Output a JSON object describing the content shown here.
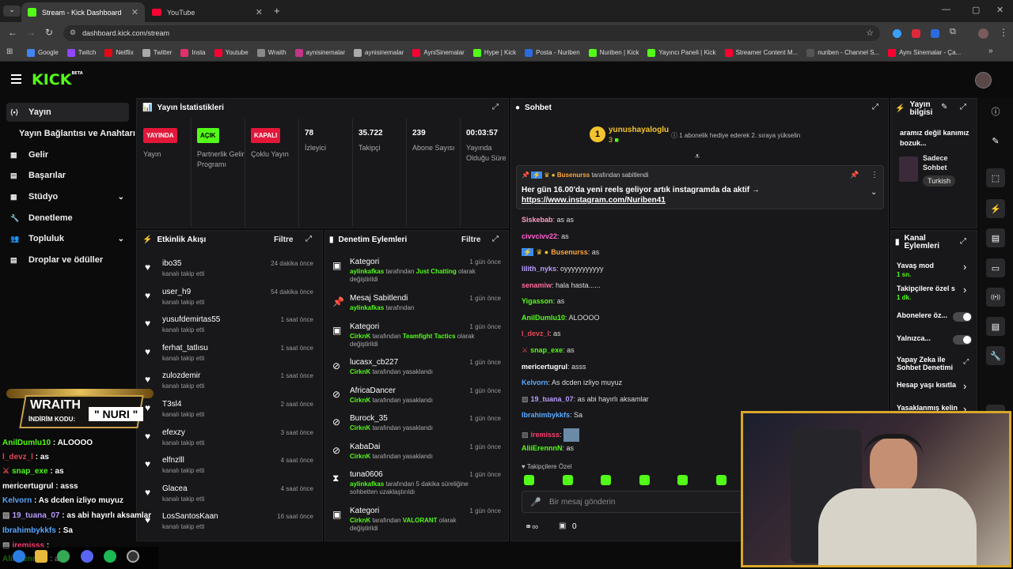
{
  "browser": {
    "tabs": [
      {
        "label": "Stream - Kick Dashboard"
      },
      {
        "label": "YouTube"
      }
    ],
    "url": "dashboard.kick.com/stream",
    "bookmarks": [
      "Google",
      "Twitch",
      "Netflix",
      "Twitter",
      "Insta",
      "Youtube",
      "Wraith",
      "aynisinemalar",
      "aynisinemalar",
      "AyniSinemalar",
      "Hype | Kick",
      "Posta - Nuriben",
      "Nuriben | Kick",
      "Yayıncı Paneli | Kick",
      "Streamer Content M...",
      "nuriben - Channel S...",
      "Aynı Sinemalar - Ça..."
    ]
  },
  "header": {
    "logo": "KICK",
    "beta": "BETA"
  },
  "sidebar": {
    "items": [
      {
        "label": "Yayın"
      },
      {
        "label": "Yayın Bağlantısı ve Anahtarı"
      },
      {
        "label": "Gelir"
      },
      {
        "label": "Başarılar"
      },
      {
        "label": "Stüdyo"
      },
      {
        "label": "Denetleme"
      },
      {
        "label": "Topluluk"
      },
      {
        "label": "Droplar ve ödüller"
      }
    ]
  },
  "stats": {
    "title": "Yayın İstatistikleri",
    "items": [
      {
        "badge": "YAYINDA",
        "label": "Yayın"
      },
      {
        "badge": "AÇIK",
        "label": "Partnerlik Gelir Programı"
      },
      {
        "badge": "KAPALI",
        "label": "Çoklu Yayın"
      },
      {
        "value": "78",
        "label": "İzleyici"
      },
      {
        "value": "35.722",
        "label": "Takipçi"
      },
      {
        "value": "239",
        "label": "Abone Sayısı"
      },
      {
        "value": "00:03:57",
        "label": "Yayında Olduğu Süre"
      }
    ]
  },
  "activity": {
    "title": "Etkinlik Akışı",
    "filter": "Filtre",
    "sub": "kanalı takip etti",
    "items": [
      {
        "name": "ibo35",
        "time": "24 dakika önce"
      },
      {
        "name": "user_h9",
        "time": "54 dakika önce"
      },
      {
        "name": "yusufdemirtas55",
        "time": "1 saat önce"
      },
      {
        "name": "ferhat_tatlısu",
        "time": "1 saat önce"
      },
      {
        "name": "zulozdemir",
        "time": "1 saat önce"
      },
      {
        "name": "T3sl4",
        "time": "2 saat önce"
      },
      {
        "name": "efexzy",
        "time": "3 saat önce"
      },
      {
        "name": "elfnzlll",
        "time": "4 saat önce"
      },
      {
        "name": "Glacea",
        "time": "4 saat önce"
      },
      {
        "name": "LosSantosKaan",
        "time": "16 saat önce"
      }
    ]
  },
  "moderation": {
    "title": "Denetim Eylemleri",
    "filter": "Filtre",
    "items": [
      {
        "name": "Kategori",
        "time": "1 gün önce",
        "user": "aylinkafkas",
        "mid": " tarafından ",
        "g2": "Just Chatting",
        "end": " olarak değiştirildi"
      },
      {
        "name": "Mesaj Sabitlendi",
        "time": "1 gün önce",
        "user": "aylinkafkas",
        "mid": " tarafından",
        "g2": "",
        "end": ""
      },
      {
        "name": "Kategori",
        "time": "1 gün önce",
        "user": "CirknK",
        "mid": " tarafından ",
        "g2": "Teamfight Tactics",
        "end": " olarak değiştirildi"
      },
      {
        "name": "lucasx_cb227",
        "time": "1 gün önce",
        "user": "CirknK",
        "mid": " tarafından yasaklandı",
        "g2": "",
        "end": ""
      },
      {
        "name": "AfricaDancer",
        "time": "1 gün önce",
        "user": "CirknK",
        "mid": " tarafından yasaklandı",
        "g2": "",
        "end": ""
      },
      {
        "name": "Burock_35",
        "time": "1 gün önce",
        "user": "CirknK",
        "mid": " tarafından yasaklandı",
        "g2": "",
        "end": ""
      },
      {
        "name": "KabaDai",
        "time": "1 gün önce",
        "user": "CirknK",
        "mid": " tarafından yasaklandı",
        "g2": "",
        "end": ""
      },
      {
        "name": "tuna0606",
        "time": "1 gün önce",
        "user": "aylinkafkas",
        "mid": " tarafından 5 dakika süreliğine sohbetten uzaklaştırıldı",
        "g2": "",
        "end": ""
      },
      {
        "name": "Kategori",
        "time": "1 gün önce",
        "user": "CirknK",
        "mid": " tarafından ",
        "g2": "VALORANT",
        "end": " olarak değiştirildi"
      }
    ]
  },
  "chat": {
    "title": "Sohbet",
    "gift_user": "yunushayaloglu",
    "gift_count": "3",
    "gift_text": "1 abonelik hediye ederek 2. sıraya yükselin",
    "pinned_by": "Busenurss",
    "pinned_by_text": " tarafından sabitlendi",
    "pinned_text": "Her gün 16.00'da yeni reels geliyor artık instagramda da aktif →",
    "pinned_link": "https://www.instagram.com/Nuriben41",
    "messages": [
      {
        "user": "Siskebab",
        "color": "#ff9ec6",
        "text": "as as"
      },
      {
        "user": "civvcivv22",
        "color": "#ff5fd0",
        "text": "as"
      },
      {
        "user": "Busenurss",
        "color": "#ffa53c",
        "text": "as"
      },
      {
        "user": "lilith_nyks",
        "color": "#b99cff",
        "text": "oyyyyyyyyyyy"
      },
      {
        "user": "senamiw",
        "color": "#ff6a9a",
        "text": "hala hasta......"
      },
      {
        "user": "Yigasson",
        "color": "#53fc18",
        "text": "as"
      },
      {
        "user": "AnilDumlu10",
        "color": "#53fc18",
        "text": "ALOOOO"
      },
      {
        "user": "l_devz_l",
        "color": "#e0485c",
        "text": "as"
      },
      {
        "user": "snap_exe",
        "color": "#53fc18",
        "text": "as"
      },
      {
        "user": "mericertugrul",
        "color": "#ffffff",
        "text": "asss"
      },
      {
        "user": "Kelvorn",
        "color": "#5aa8ff",
        "text": "As dcden izliyo muyuz"
      },
      {
        "user": "19_tuana_07",
        "color": "#b99cff",
        "text": "as abi hayırlı aksamlar"
      },
      {
        "user": "Ibrahimbykkfs",
        "color": "#5aa8ff",
        "text": "Sa"
      },
      {
        "user": "iremisss",
        "color": "#ff3d6e",
        "text": ""
      },
      {
        "user": "AliiErennnN",
        "color": "#53fc18",
        "text": "as"
      }
    ],
    "followers_only": "Takipçilere Özel",
    "input_placeholder": "Bir mesaj gönderin",
    "count": "0"
  },
  "info": {
    "title": "Yayın bilgisi",
    "stream_title": "aramız değil kanımız bozuk...",
    "category": "Sadece Sohbet",
    "lang": "Turkish"
  },
  "channel": {
    "title": "Kanal Eylemleri",
    "items": [
      {
        "label": "Yavaş mod",
        "sub": "1 sn."
      },
      {
        "label": "Takipçilere özel s",
        "sub": "1 dk."
      },
      {
        "label": "Abonelere öz..."
      },
      {
        "label": "Yalnızca..."
      },
      {
        "label": "Yapay Zeka ile Sohbet Denetimi"
      },
      {
        "label": "Hesap yaşı kısıtla"
      },
      {
        "label": "Yasaklanmış kelin"
      }
    ]
  },
  "overlay": {
    "banner_top": "WRAITH",
    "banner_code_label": "İNDİRİM KODU:",
    "banner_code": "NURI",
    "lines": [
      {
        "user": "AnilDumlu10",
        "color": "#53fc18",
        "text": "ALOOOO"
      },
      {
        "user": "l_devz_l",
        "color": "#e0485c",
        "text": "as"
      },
      {
        "user": "snap_exe",
        "color": "#53fc18",
        "text": "as"
      },
      {
        "user": "mericertugrul",
        "color": "#ffffff",
        "text": "asss"
      },
      {
        "user": "Kelvorn",
        "color": "#5aa8ff",
        "text": "As dcden izliyo muyuz"
      },
      {
        "user": "19_tuana_07",
        "color": "#b99cff",
        "text": "as abi hayırlı aksamlar"
      },
      {
        "user": "Ibrahimbykkfs",
        "color": "#5aa8ff",
        "text": "Sa"
      },
      {
        "user": "iremisss",
        "color": "#ff3d6e",
        "text": ""
      },
      {
        "user": "AliiErennnN",
        "color": "#53fc18",
        "text": "as"
      }
    ]
  }
}
